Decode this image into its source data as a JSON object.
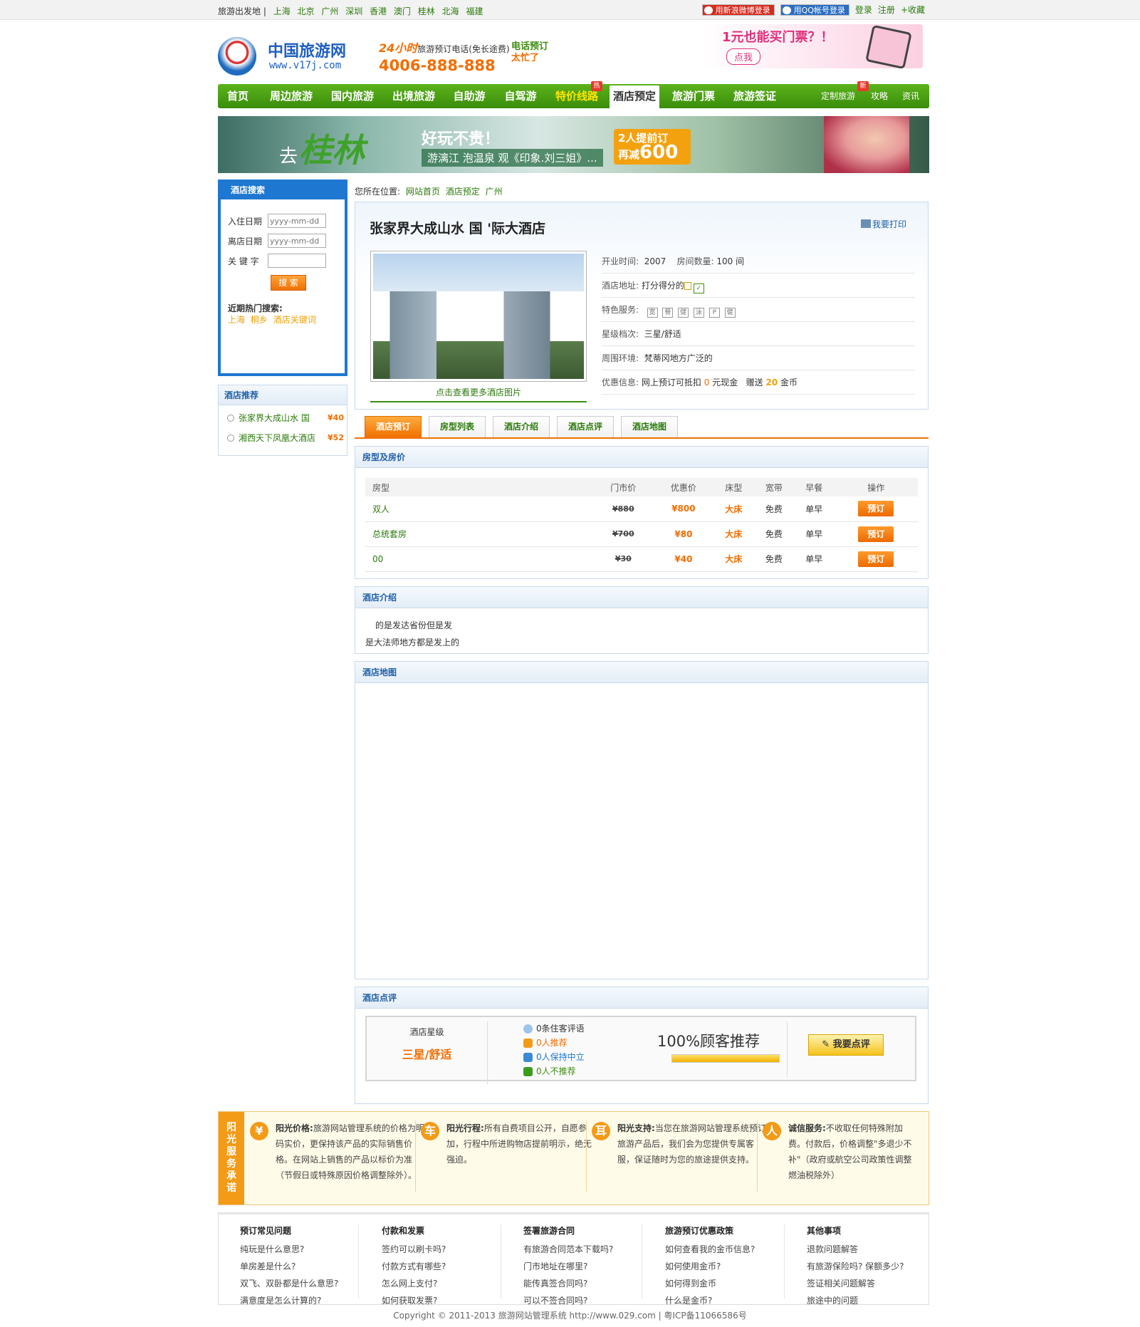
{
  "topbar": {
    "label": "旅游出发地 |",
    "cities": [
      "上海",
      "北京",
      "广州",
      "深圳",
      "香港",
      "澳门",
      "桂林",
      "北海",
      "福建"
    ],
    "weibo_login": "用新浪微博登录",
    "qq_login": "用QQ帐号登录",
    "login": "登录",
    "register": "注册",
    "favorite": "+收藏"
  },
  "header": {
    "logo_cn": "中国旅游网",
    "logo_url": "www.v17j.com",
    "hotline_hours": "24小时",
    "hotline_label": "旅游预订电话(免长途费)",
    "hotline_number": "4006-888-888",
    "hotline_busy_1": "电话预订",
    "hotline_busy_2": "太忙了",
    "ad_text": "1元也能买门票？！",
    "ad_button": "点我"
  },
  "nav": {
    "items": [
      "首页",
      "周边旅游",
      "国内旅游",
      "出境旅游",
      "自助游",
      "自驾游",
      "特价线路",
      "酒店预定",
      "旅游门票",
      "旅游签证"
    ],
    "small_items": [
      "定制旅游",
      "攻略",
      "资讯"
    ],
    "badge_hot": "热",
    "badge_new": "新"
  },
  "banner": {
    "go": "去",
    "place": "桂林",
    "slogan": "好玩不贵！",
    "desc": "游漓江 泡温泉 观《印象.刘三姐》...",
    "promo_1": "2人提前订",
    "promo_2": "再减",
    "promo_amount": "600"
  },
  "search": {
    "title": "酒店搜索",
    "checkin_label": "入住日期",
    "checkout_label": "离店日期",
    "keyword_label": "关 键 字",
    "date_placeholder": "yyyy-mm-dd",
    "button": "搜 索",
    "hot_title": "近期热门搜索:",
    "hot_links": [
      "上海",
      "桐乡",
      "酒店关键词"
    ]
  },
  "recommend": {
    "title": "酒店推荐",
    "items": [
      {
        "name": "张家界大成山水 国",
        "price": "¥40"
      },
      {
        "name": "湘西天下凤凰大酒店",
        "price": "¥52"
      }
    ]
  },
  "breadcrumb": {
    "label": "您所在位置:",
    "items": [
      "网站首页",
      "酒店预定",
      "广州"
    ]
  },
  "hotel": {
    "name": "张家界大成山水 国 '际大酒店",
    "print": "我要打印",
    "more_photos": "点击查看更多酒店图片",
    "open_label": "开业时间:",
    "open_value": "2007",
    "rooms_label": "房间数量:",
    "rooms_value": "100 间",
    "address_label": "酒店地址:",
    "address_value": "打分得分的",
    "services_label": "特色服务:",
    "services": [
      "宽",
      "餐",
      "健",
      "泳",
      "P",
      "健"
    ],
    "star_label": "星级档次:",
    "star_value": "三星/舒适",
    "env_label": "周围环境:",
    "env_value": "梵蒂冈地方广泛的",
    "offer_label": "优惠信息:",
    "offer_prefix": "网上预订可抵扣",
    "offer_cash": "0",
    "offer_mid": "元现金",
    "offer_gift": "赠送",
    "offer_coins": "20",
    "offer_suffix": "金币"
  },
  "tabs": [
    "酒店预订",
    "房型列表",
    "酒店介绍",
    "酒店点评",
    "酒店地图"
  ],
  "rooms": {
    "title": "房型及房价",
    "headers": [
      "房型",
      "门市价",
      "优惠价",
      "床型",
      "宽带",
      "早餐",
      "操作"
    ],
    "rows": [
      {
        "type": "双人",
        "list": "¥880",
        "deal": "¥800",
        "bed": "大床",
        "net": "免费",
        "breakfast": "单早",
        "action": "预订"
      },
      {
        "type": "总统套房",
        "list": "¥700",
        "deal": "¥80",
        "bed": "大床",
        "net": "免费",
        "breakfast": "单早",
        "action": "预订"
      },
      {
        "type": "00",
        "list": "¥30",
        "deal": "¥40",
        "bed": "大床",
        "net": "免费",
        "breakfast": "单早",
        "action": "预订"
      }
    ]
  },
  "intro": {
    "title": "酒店介绍",
    "line1": "的是发达省份但是发",
    "line2": "是大法师地方都是发上的"
  },
  "map": {
    "title": "酒店地图"
  },
  "review": {
    "title": "酒店点评",
    "star_label": "酒店星级",
    "star_value": "三星/舒适",
    "count": "0条住客评语",
    "recommend": "0人推荐",
    "neutral": "0人保持中立",
    "not_recommend": "0人不推荐",
    "percent": "100%顾客推荐",
    "percent_value": 100,
    "button": "我要点评"
  },
  "promise": {
    "side": "阳光服务承诺",
    "cols": [
      {
        "icon": "¥",
        "title": "阳光价格:",
        "text": "旅游网站管理系统的价格为明码实价，更保持该产品的实际销售价格。在网站上销售的产品以标价为准（节假日或特殊原因价格调整除外）。"
      },
      {
        "icon": "车",
        "title": "阳光行程:",
        "text": "所有自费项目公开，自愿参加，行程中所进购物店提前明示，绝无强迫。"
      },
      {
        "icon": "耳",
        "title": "阳光支持:",
        "text": "当您在旅游网站管理系统预订旅游产品后，我们会为您提供专属客服，保证随时为您的旅途提供支持。"
      },
      {
        "icon": "人",
        "title": "诚信服务:",
        "text": "不收取任何特殊附加费。付款后，价格调整\"多退少不补\"（政府或航空公司政策性调整燃油税除外）"
      }
    ]
  },
  "help": {
    "cols": [
      {
        "title": "预订常见问题",
        "links": [
          "纯玩是什么意思?",
          "单房差是什么?",
          "双飞、双卧都是什么意思?",
          "满意度是怎么计算的?"
        ]
      },
      {
        "title": "付款和发票",
        "links": [
          "签约可以刷卡吗?",
          "付款方式有哪些?",
          "怎么网上支付?",
          "如何获取发票?"
        ]
      },
      {
        "title": "签署旅游合同",
        "links": [
          "有旅游合同范本下载吗?",
          "门市地址在哪里?",
          "能传真签合同吗?",
          "可以不签合同吗?"
        ]
      },
      {
        "title": "旅游预订优惠政策",
        "links": [
          "如何查看我的金币信息?",
          "如何使用金币?",
          "如何得到金币",
          "什么是金币?"
        ]
      },
      {
        "title": "其他事项",
        "links": [
          "退款问题解答",
          "有旅游保险吗? 保额多少?",
          "签证相关问题解答",
          "旅途中的问题"
        ]
      }
    ]
  },
  "copyright": "Copyright © 2011-2013 旅游网站管理系统 http://www.029.com | 粤ICP备11066586号",
  "colors": {
    "green": "#3c8d0d",
    "orange": "#f36d00",
    "blue": "#1e77d0"
  }
}
